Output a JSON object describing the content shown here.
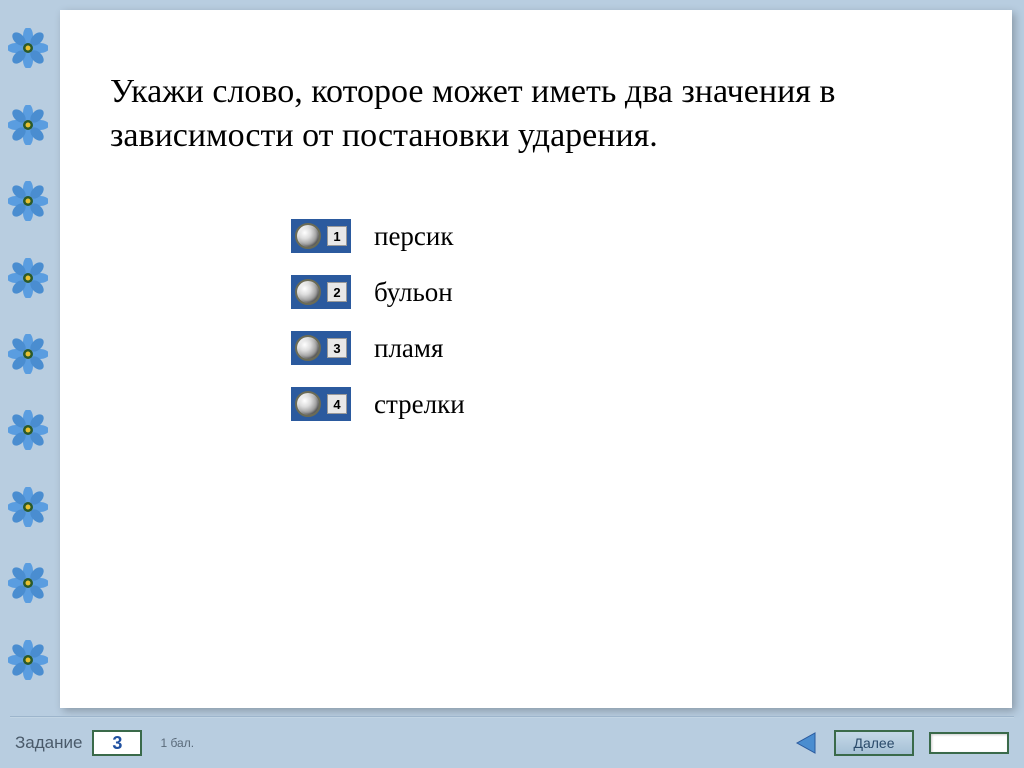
{
  "question": "Укажи слово, которое может иметь два значения в зависимости от постановки ударения.",
  "options": [
    {
      "number": "1",
      "label": "персик"
    },
    {
      "number": "2",
      "label": "бульон"
    },
    {
      "number": "3",
      "label": "пламя"
    },
    {
      "number": "4",
      "label": "стрелки"
    }
  ],
  "footer": {
    "task_label": "Задание",
    "task_number": "3",
    "points": "1 бал.",
    "next_label": "Далее"
  }
}
